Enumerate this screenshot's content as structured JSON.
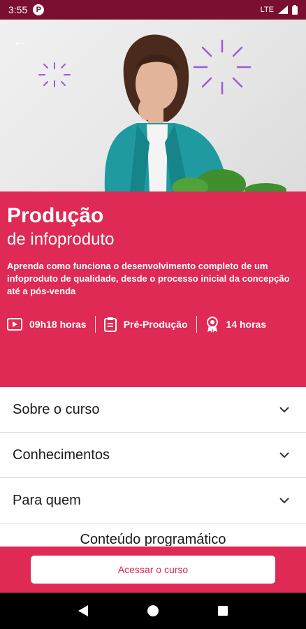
{
  "status_bar": {
    "time": "3:55",
    "network": "LTE"
  },
  "course": {
    "title": "Produção",
    "subtitle": "de infoproduto",
    "description": "Aprenda como funciona o desenvolvimento completo de um infoproduto de qualidade, desde o processo inicial da concepção até a pós-venda",
    "meta": [
      {
        "icon": "video-icon",
        "label": "09h18 horas"
      },
      {
        "icon": "clipboard-icon",
        "label": "Pré-Produção"
      },
      {
        "icon": "certificate-icon",
        "label": "14 horas"
      }
    ]
  },
  "sections": [
    {
      "label": "Sobre o curso"
    },
    {
      "label": "Conhecimentos"
    },
    {
      "label": "Para quem"
    },
    {
      "label": "Conteúdo programático"
    }
  ],
  "cta": {
    "label": "Acessar o curso"
  },
  "colors": {
    "brand": "#de2a55",
    "status_bar": "#7a0f2f",
    "accent_line": "#9d5bd6"
  }
}
